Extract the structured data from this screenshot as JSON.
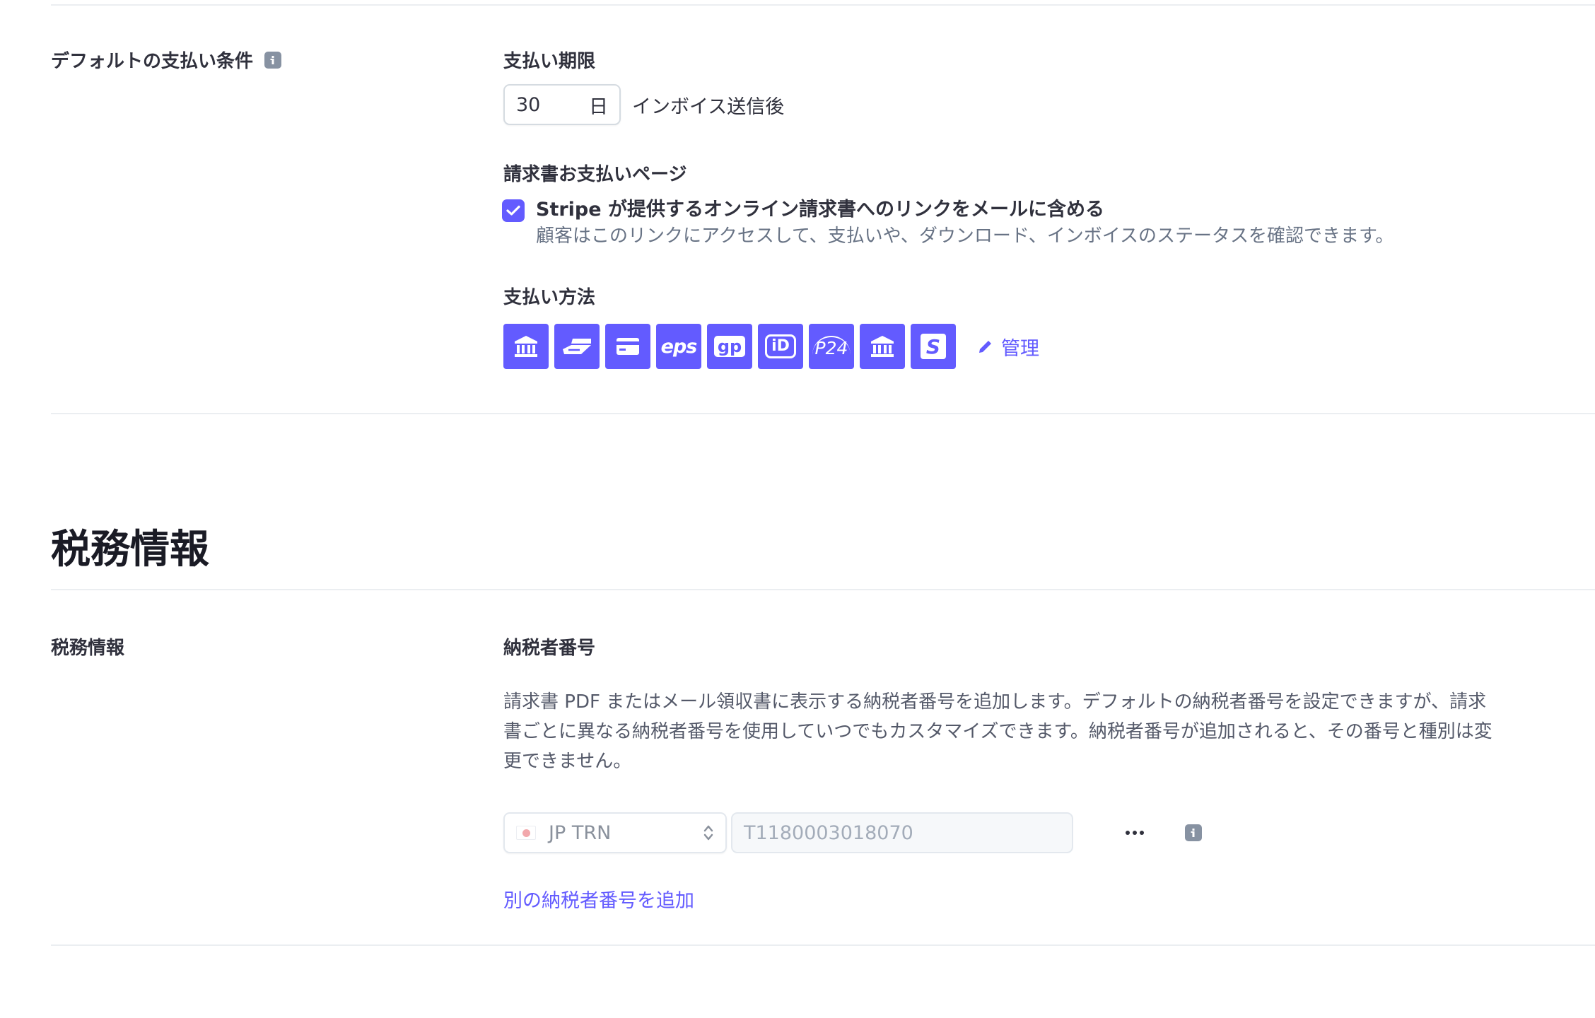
{
  "payment_terms": {
    "row_label": "デフォルトの支払い条件",
    "due_label": "支払い期限",
    "days_value": "30",
    "days_unit": "日",
    "days_after": "インボイス送信後"
  },
  "invoice_page": {
    "label": "請求書お支払いページ",
    "checkbox_checked": true,
    "checkbox_title": "Stripe が提供するオンライン請求書へのリンクをメールに含める",
    "checkbox_desc": "顧客はこのリンクにアクセスして、支払いや、ダウンロード、インボイスのステータスを確認できます。"
  },
  "payment_methods": {
    "label": "支払い方法",
    "icons": [
      "bank-icon",
      "card-swipe-icon",
      "card-icon",
      "eps-icon",
      "giropay-icon",
      "ideal-icon",
      "p24-icon",
      "bank-icon",
      "sofort-icon"
    ],
    "icon_texts": {
      "eps": "eps",
      "giropay": "gp",
      "ideal": "iD",
      "p24": "P24",
      "sofort": "S"
    },
    "manage_label": "管理"
  },
  "tax": {
    "section_title": "税務情報",
    "row_label": "税務情報",
    "id_label": "納税者番号",
    "description": "請求書 PDF またはメール領収書に表示する納税者番号を追加します。デフォルトの納税者番号を設定できますが、請求書ごとに異なる納税者番号を使用していつでもカスタマイズできます。納税者番号が追加されると、その番号と種別は変更できません。",
    "id_type": "JP TRN",
    "id_value": "T1180003018070",
    "add_label": "別の納税者番号を追加"
  },
  "colors": {
    "accent": "#635bff",
    "text": "#30313d",
    "muted": "#687385",
    "border": "#ebeef1"
  }
}
